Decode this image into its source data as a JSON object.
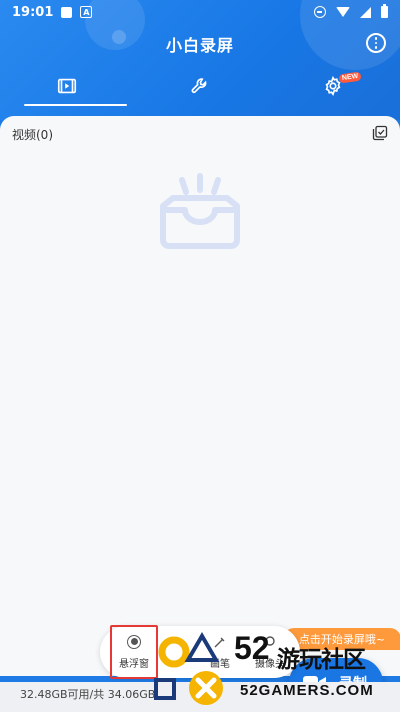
{
  "status_bar": {
    "time": "19:01",
    "notification_letter": "A"
  },
  "header": {
    "title": "小白录屏",
    "new_badge": "NEW"
  },
  "tabs": [
    {
      "icon": "video-list-icon",
      "active": true
    },
    {
      "icon": "wrench-icon",
      "active": false
    },
    {
      "icon": "settings-gear-icon",
      "active": false
    }
  ],
  "content": {
    "video_label": "视频(0)"
  },
  "record": {
    "tip": "点击开始录屏哦~",
    "label": "录制"
  },
  "quick_panel": {
    "float_window": "悬浮窗",
    "brush": "画笔",
    "camera": "摄像头"
  },
  "storage": {
    "text": "32.48GB可用/共 34.06GB"
  },
  "watermark": {
    "number": "52",
    "name": "游玩社区",
    "english": "52GAMERS.COM"
  },
  "colors": {
    "primary": "#1e7be6",
    "accent_orange": "#ff9a3c",
    "badge_red": "#ff5a3c",
    "empty_icon": "#d8e0f5"
  }
}
